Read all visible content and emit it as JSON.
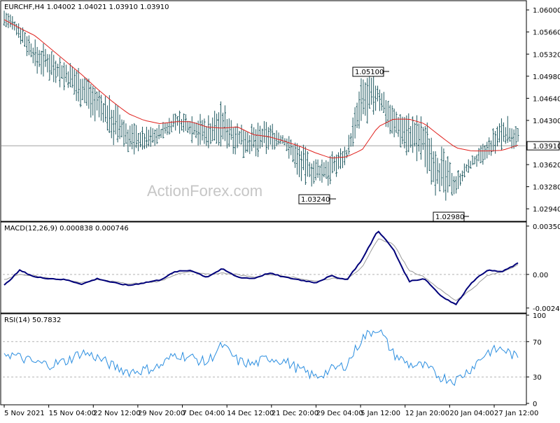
{
  "header": {
    "symbol_line": "EURCHF,H4  1.04002 1.04021 1.03910 1.03910",
    "macd_line": "MACD(12,26,9) 0.000838 0.000746",
    "rsi_line": "RSI(14) 50.7832",
    "watermark": "ActionForex.com"
  },
  "colors": {
    "background": "#ffffff",
    "frame": "#000000",
    "price_bars": "#1f5960",
    "moving_average": "#e0211d",
    "macd_main": "#00007a",
    "macd_signal": "#9a9a9a",
    "rsi_line": "#2b8ee0",
    "grid_dash": "#b4b4b4",
    "callout_text": "#0000a0"
  },
  "chart_data": [
    {
      "type": "candlestick",
      "panel": "price",
      "symbol": "EURCHF",
      "timeframe": "H4",
      "ylim": [
        1.0278,
        1.0612
      ],
      "yticks": [
        1.06,
        1.0566,
        1.0532,
        1.0498,
        1.0464,
        1.043,
        1.0362,
        1.0328,
        1.0294
      ],
      "ytick_labels": [
        "1.06000",
        "1.05660",
        "1.05320",
        "1.04980",
        "1.04640",
        "1.04300",
        "1.03620",
        "1.03280",
        "1.02940"
      ],
      "current_price": 1.0391,
      "current_price_label": "1.03910",
      "ohlc_last": {
        "open": 1.04002,
        "high": 1.04021,
        "low": 1.0391,
        "close": 1.0391
      },
      "annotations": [
        {
          "label": "1.05100",
          "x": "5 Jan 12:00",
          "y": 1.051
        },
        {
          "label": "1.03240",
          "x": "30 Dec 16:00",
          "y": 1.0324
        },
        {
          "label": "1.02980",
          "x": "21 Jan 16:00",
          "y": 1.0298
        }
      ],
      "series": [
        {
          "kind": "high_low",
          "dates": [
            "5 Nov 2021",
            "9 Nov",
            "12 Nov",
            "15 Nov 04:00",
            "18 Nov",
            "22 Nov 12:00",
            "24 Nov",
            "27 Nov",
            "29 Nov 20:00",
            "2 Dec",
            "5 Dec",
            "7 Dec 04:00",
            "9 Dec",
            "11 Dec",
            "14 Dec 12:00",
            "16 Dec",
            "19 Dec",
            "21 Dec 20:00",
            "24 Dec",
            "27 Dec",
            "29 Dec 04:00",
            "31 Dec",
            "3 Jan",
            "5 Jan 12:00",
            "7 Jan",
            "10 Jan",
            "12 Jan 20:00",
            "15 Jan",
            "18 Jan",
            "20 Jan 04:00",
            "22 Jan",
            "25 Jan",
            "27 Jan 12:00",
            "28 Jan"
          ],
          "highs": [
            1.0605,
            1.0585,
            1.0555,
            1.0545,
            1.0525,
            1.0515,
            1.0485,
            1.0465,
            1.0432,
            1.042,
            1.0425,
            1.0448,
            1.0445,
            1.044,
            1.0462,
            1.0432,
            1.0425,
            1.0432,
            1.0412,
            1.0398,
            1.0375,
            1.0382,
            1.0395,
            1.0505,
            1.0498,
            1.0455,
            1.0445,
            1.0438,
            1.0398,
            1.0352,
            1.0375,
            1.0402,
            1.0445,
            1.0422
          ],
          "lows": [
            1.057,
            1.055,
            1.05,
            1.049,
            1.047,
            1.0445,
            1.0425,
            1.039,
            1.0375,
            1.038,
            1.0395,
            1.041,
            1.0395,
            1.038,
            1.0385,
            1.0375,
            1.0368,
            1.038,
            1.0385,
            1.0335,
            1.0322,
            1.033,
            1.0365,
            1.0415,
            1.044,
            1.04,
            1.037,
            1.0355,
            1.0295,
            1.0315,
            1.0355,
            1.036,
            1.0378,
            1.0388
          ]
        },
        {
          "kind": "moving_average",
          "values": [
            1.0585,
            1.0572,
            1.056,
            1.054,
            1.052,
            1.05,
            1.0478,
            1.0458,
            1.044,
            1.043,
            1.0425,
            1.0428,
            1.0428,
            1.042,
            1.0418,
            1.042,
            1.0408,
            1.0405,
            1.0398,
            1.039,
            1.038,
            1.0372,
            1.0374,
            1.0385,
            1.042,
            1.0432,
            1.0432,
            1.0425,
            1.0406,
            1.0388,
            1.0383,
            1.0383,
            1.0384,
            1.0392
          ]
        }
      ]
    },
    {
      "type": "line",
      "panel": "macd",
      "title": "MACD(12,26,9) 0.000838 0.000746",
      "ylim": [
        -0.0027,
        0.0037
      ],
      "ytick_labels": [
        "0.003505",
        "0.00",
        "-0.002438"
      ],
      "yticks": [
        0.003505,
        0.0,
        -0.002438
      ],
      "zero_line": 0.0,
      "series": [
        {
          "name": "MACD",
          "values": [
            -0.0008,
            0.0003,
            -0.0002,
            -0.0003,
            -0.0004,
            -0.0007,
            -0.0003,
            -0.0006,
            -0.0008,
            -0.0006,
            -0.0004,
            0.0002,
            0.0003,
            -0.0002,
            0.0004,
            -0.0002,
            -0.0003,
            0.0001,
            -0.0002,
            -0.0004,
            -0.0006,
            -0.0001,
            -0.0004,
            0.0011,
            0.0032,
            0.0018,
            -0.0005,
            -0.0003,
            -0.0015,
            -0.0022,
            -0.0006,
            0.0003,
            0.0002,
            0.0008
          ]
        },
        {
          "name": "Signal",
          "values": [
            -0.0004,
            0.0,
            -0.0001,
            -0.0003,
            -0.0004,
            -0.0006,
            -0.0004,
            -0.0005,
            -0.0007,
            -0.0006,
            -0.0005,
            0.0,
            0.0002,
            0.0,
            0.0001,
            0.0,
            -0.0002,
            0.0,
            -0.0001,
            -0.0003,
            -0.0005,
            -0.0003,
            -0.0003,
            0.0005,
            0.0026,
            0.0022,
            0.0003,
            -0.0002,
            -0.0011,
            -0.0019,
            -0.0011,
            -0.0001,
            0.0002,
            0.0007
          ]
        }
      ]
    },
    {
      "type": "line",
      "panel": "rsi",
      "title": "RSI(14) 50.7832",
      "ylim": [
        0,
        100
      ],
      "yticks": [
        100,
        70,
        30,
        0
      ],
      "ytick_labels": [
        "100",
        "70",
        "30",
        "0"
      ],
      "levels": [
        70,
        30
      ],
      "series": [
        {
          "name": "RSI(14)",
          "values": [
            58,
            52,
            46,
            44,
            48,
            58,
            52,
            42,
            36,
            38,
            42,
            56,
            52,
            46,
            66,
            48,
            44,
            52,
            48,
            38,
            30,
            38,
            44,
            74,
            86,
            56,
            44,
            42,
            30,
            26,
            40,
            58,
            62,
            51
          ]
        }
      ],
      "xtick_labels": [
        "5 Nov 2021",
        "15 Nov 04:00",
        "22 Nov 12:00",
        "29 Nov 20:00",
        "7 Dec 04:00",
        "14 Dec 12:00",
        "21 Dec 20:00",
        "29 Dec 04:00",
        "5 Jan 12:00",
        "12 Jan 20:00",
        "20 Jan 04:00",
        "27 Jan 12:00"
      ]
    }
  ]
}
